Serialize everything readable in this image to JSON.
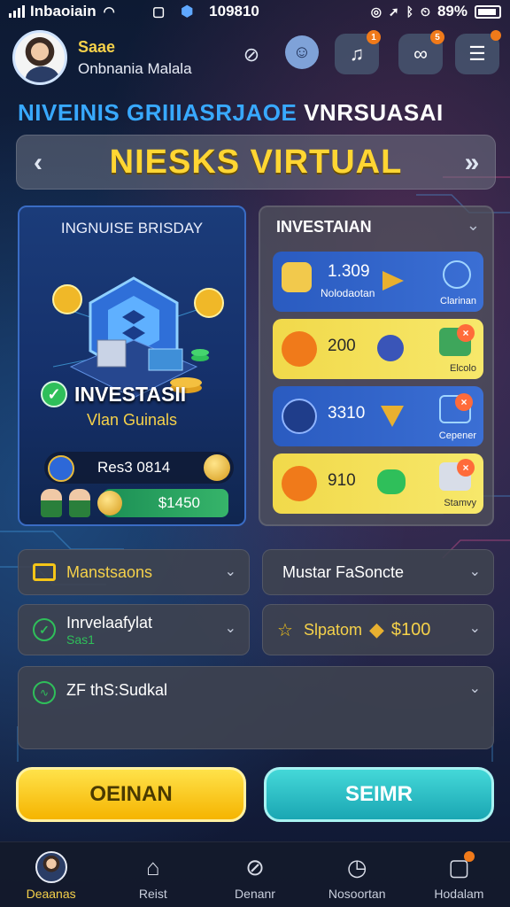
{
  "status_bar": {
    "carrier": "Inbaoiain",
    "time": "109810",
    "battery": "89%"
  },
  "header": {
    "user_name": "Saae",
    "user_subtitle": "Onbnania Malala",
    "notification_counts": [
      "1",
      "5"
    ]
  },
  "headline": {
    "blue_part": "NIVEINIS GRIIIASRJAOE",
    "white_part": "VNRSUASAI"
  },
  "banner": {
    "title": "NIESKS VIRTUAL",
    "prev": "‹",
    "next": "»"
  },
  "feature_card": {
    "title": "INGNUISE BRISDAY",
    "main_label": "INVESTASII",
    "sub_label": "Vlan Guinals",
    "row_label": "Res3 0814",
    "amount": "$1450"
  },
  "invest_list": {
    "title": "INVESTAIAN",
    "rows": [
      {
        "value": "1.309",
        "sub": "Nolodaotan",
        "caption": "Clarinan",
        "style": "blue",
        "left_color": "#f2c94c",
        "badge": ""
      },
      {
        "value": "200",
        "sub": "",
        "caption": "Elcolo",
        "style": "yellow",
        "left_color": "#f07a1a",
        "badge": "×"
      },
      {
        "value": "3310",
        "sub": "",
        "caption": "Cepener",
        "style": "blue",
        "left_color": "#1f3d8a",
        "badge": "×"
      },
      {
        "value": "910",
        "sub": "",
        "caption": "Stamvy",
        "style": "yellow",
        "left_color": "#f07a1a",
        "badge": "×"
      }
    ]
  },
  "dropdowns": {
    "d1": "Manstsaons",
    "d2": "Mustar FaSoncte",
    "d3_line1": "Inrvelaafylat",
    "d3_line2": "Sas1",
    "d4_label": "Slpatom",
    "d4_amount": "$100",
    "d5": "ZF thS:Sudkal"
  },
  "buttons": {
    "primary": "OEINAN",
    "secondary": "SEIMR"
  },
  "bottom_nav": [
    {
      "label": "Deaanas",
      "icon": "avatar-icon",
      "active": true
    },
    {
      "label": "Reist",
      "icon": "home-icon",
      "active": false
    },
    {
      "label": "Denanr",
      "icon": "compass-icon",
      "active": false
    },
    {
      "label": "Nosoortan",
      "icon": "clock-icon",
      "active": false
    },
    {
      "label": "Hodalam",
      "icon": "square-icon",
      "active": false
    }
  ],
  "colors": {
    "accent_yellow": "#f5d14a",
    "accent_blue": "#38a9ff",
    "success_green": "#2fbf5a",
    "teal": "#1aa6b3"
  }
}
